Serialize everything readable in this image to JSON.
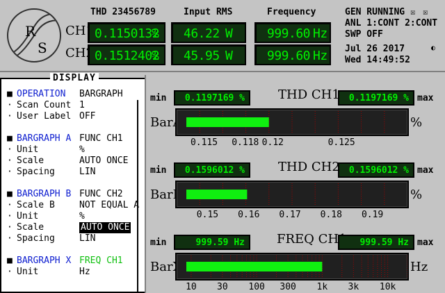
{
  "header": {
    "thd_title": "THD 23456789",
    "rms_title": "Input RMS",
    "freq_title": "Frequency",
    "ch1_label": "CH1",
    "ch2_label": "CH2",
    "ch1": {
      "thd": "0.1150132",
      "thd_unit": "%",
      "rms": "46.22",
      "rms_unit": "W",
      "freq": "999.60",
      "freq_unit": "Hz"
    },
    "ch2": {
      "thd": "0.1512402",
      "thd_unit": "%",
      "rms": "45.95",
      "rms_unit": "W",
      "freq": "999.60",
      "freq_unit": "Hz"
    },
    "gen_status": "GEN RUNNING",
    "anl_status": "ANL 1:CONT 2:CONT",
    "swp_status": "SWP OFF",
    "date": "Jul 26 2017",
    "time": "Wed 14:49:52",
    "logo_text": "R S"
  },
  "menu": {
    "title": "DISPLAY",
    "rows": [
      {
        "bullet": "■",
        "key": "OPERATION",
        "value": "BARGRAPH",
        "key_color": "blue"
      },
      {
        "bullet": "·",
        "key": "Scan Count",
        "value": "1"
      },
      {
        "bullet": "·",
        "key": "User Label",
        "value": "OFF"
      },
      {
        "bullet": "■",
        "key": "BARGRAPH A",
        "value": "FUNC CH1",
        "key_color": "blue"
      },
      {
        "bullet": "·",
        "key": "Unit",
        "value": "%"
      },
      {
        "bullet": "·",
        "key": "Scale",
        "value": "AUTO ONCE"
      },
      {
        "bullet": "·",
        "key": "Spacing",
        "value": "LIN"
      },
      {
        "bullet": "■",
        "key": "BARGRAPH B",
        "value": "FUNC CH2",
        "key_color": "blue"
      },
      {
        "bullet": "·",
        "key": "Scale B",
        "value": "NOT EQUAL A"
      },
      {
        "bullet": "·",
        "key": "Unit",
        "value": "%"
      },
      {
        "bullet": "·",
        "key": "Scale",
        "value": "AUTO ONCE",
        "selected": true
      },
      {
        "bullet": "·",
        "key": "Spacing",
        "value": "LIN"
      },
      {
        "bullet": "■",
        "key": "BARGRAPH X",
        "value": "FREQ CH1",
        "key_color": "blue",
        "value_color": "green"
      },
      {
        "bullet": "·",
        "key": "Unit",
        "value": "Hz"
      }
    ]
  },
  "bargraphs": [
    {
      "name": "BarA",
      "title": "THD  CH1",
      "unit": "%",
      "min_label": "min",
      "max_label": "max",
      "min_value": "0.1197169 %",
      "max_value": "0.1197169 %",
      "value": 0.1197169,
      "scale_min": 0.113,
      "scale_max": 0.1298,
      "log": false,
      "ticks": [
        "0.115",
        "0.118",
        "0.12",
        "0.125"
      ],
      "tick_values": [
        0.115,
        0.118,
        0.12,
        0.125
      ]
    },
    {
      "name": "BarB",
      "title": "THD  CH2",
      "unit": "%",
      "min_label": "min",
      "max_label": "max",
      "min_value": "0.1596012 %",
      "max_value": "0.1596012 %",
      "value": 0.1596012,
      "scale_min": 0.1425,
      "scale_max": 0.1985,
      "log": false,
      "ticks": [
        "0.15",
        "0.16",
        "0.17",
        "0.18",
        "0.19"
      ],
      "tick_values": [
        0.15,
        0.16,
        0.17,
        0.18,
        0.19
      ]
    },
    {
      "name": "BarX",
      "title": "FREQ CH1",
      "unit": "Hz",
      "min_label": "min",
      "max_label": "max",
      "min_value": "999.59  Hz",
      "max_value": "999.59  Hz",
      "value": 999.59,
      "scale_min": 6.0,
      "scale_max": 20000,
      "log": true,
      "ticks": [
        "10",
        "30",
        "100",
        "300",
        "1k",
        "3k",
        "10k"
      ],
      "tick_values": [
        10,
        30,
        100,
        300,
        1000,
        3000,
        10000
      ]
    }
  ],
  "colors": {
    "lcd_bg": "#103010",
    "lcd_text": "#00f000",
    "bar_fill": "#10f010",
    "grid": "#a00000"
  }
}
